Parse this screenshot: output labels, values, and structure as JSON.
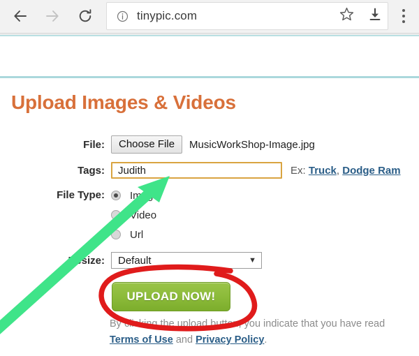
{
  "browser": {
    "back_icon": "back-arrow-icon",
    "forward_icon": "forward-arrow-icon",
    "reload_icon": "reload-icon",
    "info_icon": "info-circle-icon",
    "url": "tinypic.com",
    "bookmark_icon": "star-icon",
    "download_icon": "download-icon",
    "menu_icon": "three-dot-menu-icon"
  },
  "page": {
    "heading": "Upload Images & Videos",
    "rule_color": "#abd8dc"
  },
  "form": {
    "file": {
      "label": "File:",
      "button_label": "Choose File",
      "file_name": "MusicWorkShop-Image.jpg"
    },
    "tags": {
      "label": "Tags:",
      "value": "Judith",
      "placeholder": "",
      "highlight_color": "#d9a441",
      "example_prefix": "Ex:",
      "examples": [
        "Truck",
        "Dodge Ram"
      ],
      "example_separator": ","
    },
    "file_type": {
      "label": "File Type:",
      "options": [
        {
          "label": "Image",
          "checked": true
        },
        {
          "label": "Video",
          "checked": false
        },
        {
          "label": "Url",
          "checked": false
        }
      ]
    },
    "resize": {
      "label": "Resize:",
      "value": "Default",
      "caret": "▼"
    },
    "upload": {
      "label": "UPLOAD NOW!",
      "color": "#8cbb3a"
    },
    "disclaimer": {
      "line1": "By clicking the upload button, you indicate that you have read",
      "terms_link": "Terms of Use",
      "conjunction": "and",
      "privacy_link": "Privacy Policy",
      "period": "."
    }
  },
  "annotations": {
    "arrow": {
      "name": "green-arrow-annotation",
      "color": "#3fe489",
      "points_at": "tags-input"
    },
    "circle": {
      "name": "red-circle-annotation",
      "color": "#e01b1b",
      "encircles": "upload-now-button"
    }
  }
}
